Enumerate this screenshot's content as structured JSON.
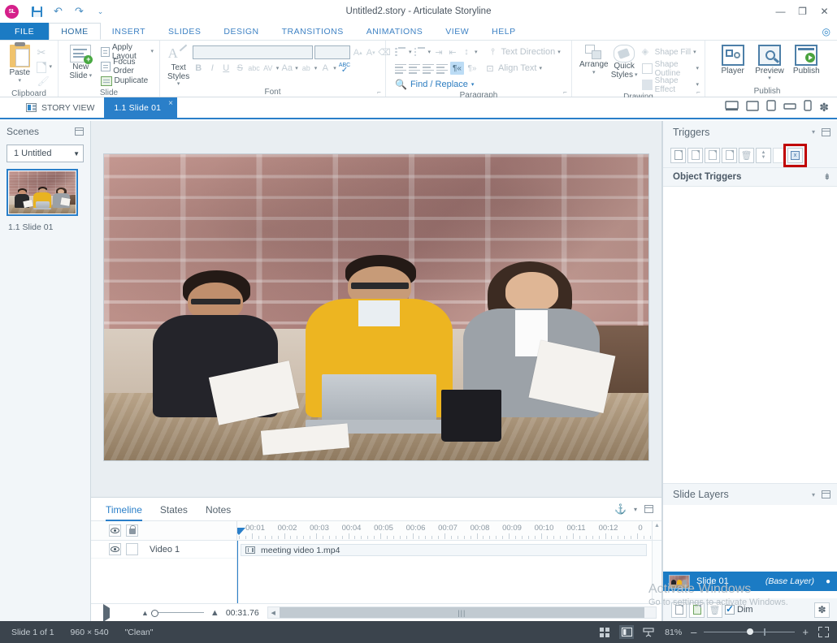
{
  "window": {
    "title": "Untitled2.story - Articulate Storyline",
    "app_orb": "storyline-orb",
    "quick_access": [
      {
        "name": "save-icon",
        "label": "Save"
      },
      {
        "name": "undo-icon",
        "label": "↶"
      },
      {
        "name": "redo-icon",
        "label": "↷"
      },
      {
        "name": "customize-qat-icon",
        "label": "⌄"
      }
    ],
    "controls": [
      {
        "name": "minimize-button",
        "glyph": "—"
      },
      {
        "name": "restore-button",
        "glyph": "❐"
      },
      {
        "name": "close-button",
        "glyph": "✕"
      }
    ],
    "help_glyph": "?"
  },
  "ribbon": {
    "tabs": [
      {
        "label": "FILE",
        "active": false
      },
      {
        "label": "HOME",
        "active": true
      },
      {
        "label": "INSERT",
        "active": false
      },
      {
        "label": "SLIDES",
        "active": false
      },
      {
        "label": "DESIGN",
        "active": false
      },
      {
        "label": "TRANSITIONS",
        "active": false
      },
      {
        "label": "ANIMATIONS",
        "active": false
      },
      {
        "label": "VIEW",
        "active": false
      },
      {
        "label": "HELP",
        "active": false
      }
    ],
    "groups": {
      "clipboard": {
        "label": "Clipboard",
        "paste": "Paste",
        "cut": "Cut",
        "copy": "Copy",
        "format_painter": "Format Painter"
      },
      "slide": {
        "label": "Slide",
        "new_slide": "New\nSlide",
        "new_slide_line1": "New",
        "new_slide_line2": "Slide",
        "apply_layout": "Apply Layout",
        "focus_order": "Focus Order",
        "duplicate": "Duplicate"
      },
      "font": {
        "label": "Font",
        "text_styles": "Text Styles",
        "font_name_value": "",
        "font_size_value": "",
        "grow_font": "A",
        "shrink_font": "A",
        "clear_formatting": "Clear Formatting",
        "bold": "B",
        "italic": "I",
        "underline": "U",
        "strikethrough": "S",
        "character_spacing": "AV",
        "change_case": "Aa",
        "text_highlight": "ab",
        "font_color": "A",
        "spell_check": "ABC"
      },
      "paragraph": {
        "label": "Paragraph",
        "text_direction": "Text Direction",
        "align_text": "Align Text",
        "find_replace": "Find / Replace"
      },
      "drawing": {
        "label": "Drawing",
        "arrange": "Arrange",
        "quick_styles_line1": "Quick",
        "quick_styles_line2": "Styles",
        "shape_fill": "Shape Fill",
        "shape_outline": "Shape Outline",
        "shape_effect": "Shape Effect"
      },
      "publish": {
        "label": "Publish",
        "player": "Player",
        "preview": "Preview",
        "publish": "Publish"
      }
    }
  },
  "viewstrip": {
    "story_view": "STORY VIEW",
    "slide_tab": "1.1 Slide 01",
    "close_glyph": "×",
    "devices": [
      {
        "name": "device-desktop-icon"
      },
      {
        "name": "device-tablet-landscape-icon"
      },
      {
        "name": "device-tablet-portrait-icon"
      },
      {
        "name": "device-small-landscape-icon"
      },
      {
        "name": "device-phone-icon"
      },
      {
        "name": "player-settings-gear-icon"
      }
    ]
  },
  "scenes": {
    "title": "Scenes",
    "scene_select_value": "1 Untitled",
    "slide_label": "1.1 Slide 01"
  },
  "triggers": {
    "title": "Triggers",
    "section_title": "Object Triggers",
    "toolbar": [
      {
        "name": "new-trigger-button",
        "label": "New Trigger"
      },
      {
        "name": "edit-trigger-button",
        "label": "Edit Trigger"
      },
      {
        "name": "copy-trigger-button",
        "label": "Copy Trigger"
      },
      {
        "name": "paste-trigger-button",
        "label": "Paste Trigger"
      },
      {
        "name": "delete-trigger-button",
        "label": "Delete Trigger"
      },
      {
        "name": "move-trigger-button",
        "label": "Move Trigger"
      },
      {
        "name": "trigger-color-button",
        "label": "Color"
      },
      {
        "name": "trigger-wizard-button",
        "label": "Trigger Wizard",
        "highlighted": true
      }
    ],
    "highlight_color": "#c00000"
  },
  "slide_layers": {
    "title": "Slide Layers",
    "layer_name": "Slide 01",
    "layer_type": "(Base Layer)",
    "dim_label": "Dim",
    "toolbar": [
      {
        "name": "new-layer-button"
      },
      {
        "name": "duplicate-layer-button"
      },
      {
        "name": "delete-layer-button"
      },
      {
        "name": "layer-properties-gear-button"
      }
    ]
  },
  "timeline": {
    "tabs": [
      {
        "label": "Timeline",
        "active": true
      },
      {
        "label": "States",
        "active": false
      },
      {
        "label": "Notes",
        "active": false
      }
    ],
    "ruler_labels": [
      "00:01",
      "00:02",
      "00:03",
      "00:04",
      "00:05",
      "00:06",
      "00:07",
      "00:08",
      "00:09",
      "00:10",
      "00:11",
      "00:12"
    ],
    "partial_label": "0",
    "rows": [
      {
        "name": "Video 1",
        "clip": "meeting video 1.mp4"
      }
    ],
    "duration": "00:31.76",
    "play_label": "Play",
    "stop_label": "Stop"
  },
  "canvas": {
    "media_name": "meeting video 1.mp4",
    "description": "meeting photo: three people with laptop at brick-wall office"
  },
  "watermark": {
    "line1": "Activate Windows",
    "line2": "Go to settings to activate Windows."
  },
  "statusbar": {
    "slide_counter": "Slide 1 of 1",
    "dimensions": "960 × 540",
    "theme": "\"Clean\"",
    "zoom": "81%",
    "zoom_out": "–",
    "zoom_in": "+",
    "views": [
      {
        "name": "normal-view-button"
      },
      {
        "name": "slide-view-button"
      },
      {
        "name": "presenter-view-button"
      }
    ],
    "fit_button": "fit-to-window-button"
  }
}
